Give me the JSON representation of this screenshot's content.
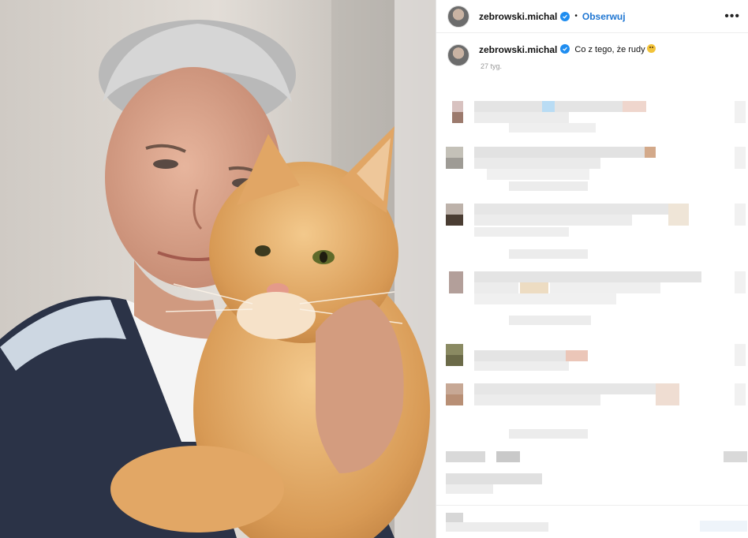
{
  "post": {
    "author": "zebrowski.michal",
    "follow_label": "Obserwuj",
    "separator": "•",
    "more_label": "•••",
    "caption": "Co z tego, że rudy",
    "time": "27 tyg."
  },
  "colors": {
    "link": "#1f76d2",
    "verified": "#1f8df0"
  },
  "icons": {
    "verified": "verified-badge-icon",
    "emoji": "grinning-face-icon",
    "more": "more-options-icon"
  }
}
